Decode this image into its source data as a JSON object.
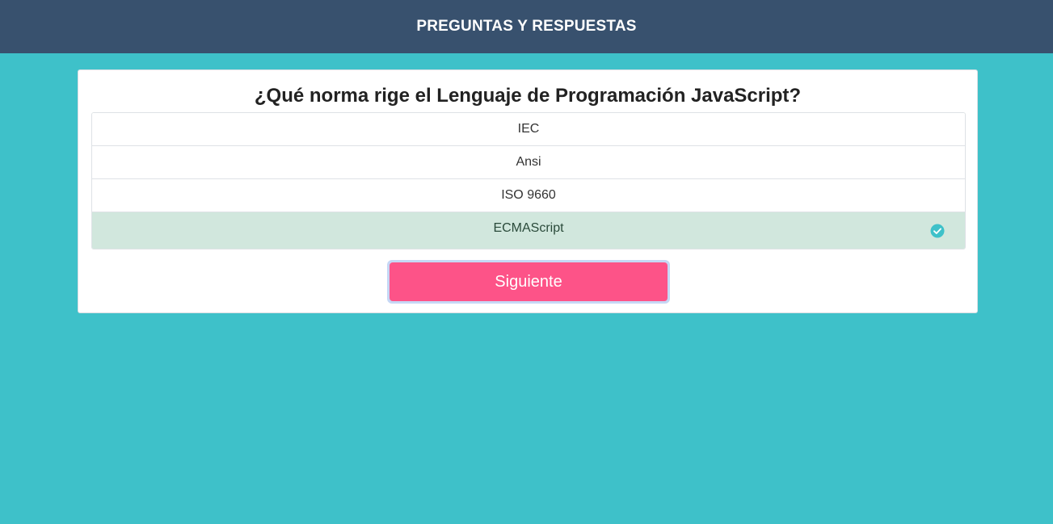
{
  "header": {
    "title": "PREGUNTAS Y RESPUESTAS"
  },
  "quiz": {
    "question": "¿Qué norma rige el Lenguaje de Programación JavaScript?",
    "answers": [
      {
        "label": "IEC",
        "state": "default"
      },
      {
        "label": "Ansi",
        "state": "default"
      },
      {
        "label": "ISO 9660",
        "state": "default"
      },
      {
        "label": "ECMAScript",
        "state": "correct",
        "icon": "check-circle-icon"
      }
    ],
    "next_label": "Siguiente"
  },
  "colors": {
    "background": "#3ec1c9",
    "header": "#38516e",
    "correct_bg": "#d1e7dd",
    "check_icon": "#3ec1c9",
    "button": "#fd5388",
    "button_focus_ring": "#c6d7f5"
  }
}
